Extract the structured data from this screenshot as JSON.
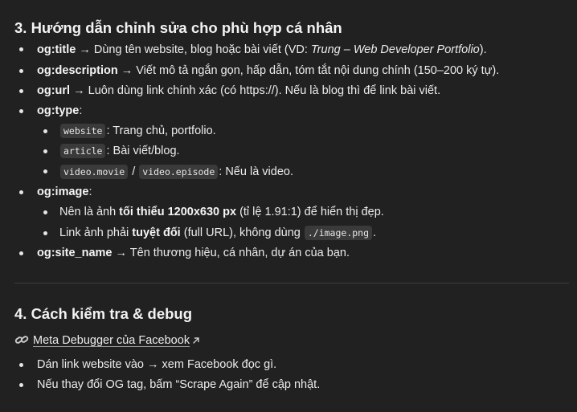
{
  "section3": {
    "heading": "3. Hướng dẫn chỉnh sửa cho phù hợp cá nhân",
    "title_key": "og:title",
    "title_pre": " → Dùng tên website, blog hoặc bài viết (VD: ",
    "title_em": "Trung – Web Developer Portfolio",
    "title_post": ").",
    "desc_key": "og:description",
    "desc_text": " → Viết mô tả ngắn gọn, hấp dẫn, tóm tắt nội dung chính (150–200 ký tự).",
    "url_key": "og:url",
    "url_text": " → Luôn dùng link chính xác (có https://). Nếu là blog thì để link bài viết.",
    "type_key": "og:type",
    "type_colon": ":",
    "type_website_code": "website",
    "type_website_text": ": Trang chủ, portfolio.",
    "type_article_code": "article",
    "type_article_text": ": Bài viết/blog.",
    "type_video_movie": "video.movie",
    "type_slash": " / ",
    "type_video_episode": "video.episode",
    "type_video_text": ": Nếu là video.",
    "image_key": "og:image",
    "image_colon": ":",
    "image1_pre": "Nên là ảnh ",
    "image1_bold": "tối thiểu 1200x630 px",
    "image1_post": " (tỉ lệ 1.91:1) để hiển thị đẹp.",
    "image2_pre": "Link ảnh phải ",
    "image2_bold": "tuyệt đối",
    "image2_mid": " (full URL), không dùng ",
    "image2_code": "./image.png",
    "image2_post": ".",
    "site_key": "og:site_name",
    "site_text": " → Tên thương hiệu, cá nhân, dự án của bạn."
  },
  "section4": {
    "heading": "4. Cách kiểm tra & debug",
    "link_label": "Meta Debugger của Facebook",
    "step1": "Dán link website vào → xem Facebook đọc gì.",
    "step2": "Nếu thay đổi OG tag, bấm “Scrape Again” để cập nhật."
  },
  "icons": {
    "link": "link-chain-icon",
    "external": "external-arrow-icon"
  }
}
